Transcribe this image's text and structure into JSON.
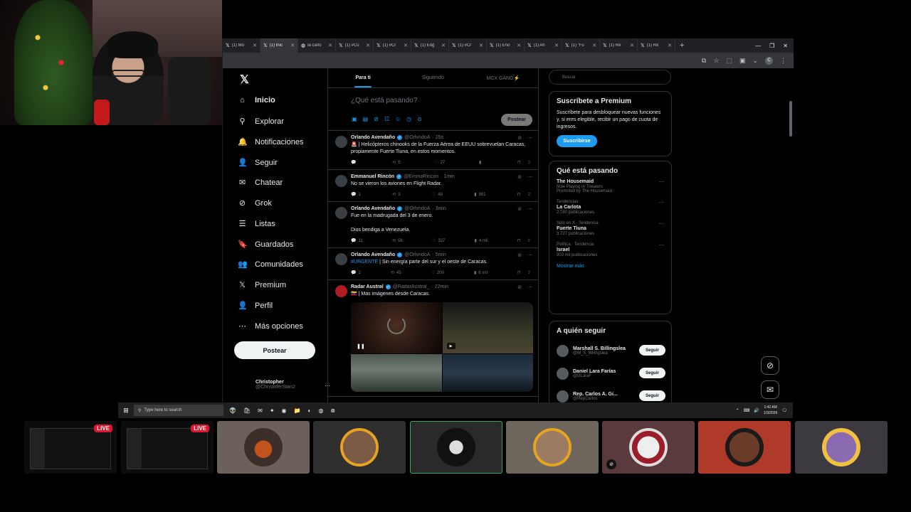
{
  "colors": {
    "accent": "#1d9bf0",
    "live": "#e0162e",
    "selected_border": "#3ba55d"
  },
  "browser": {
    "tabs": [
      {
        "icon": "x-icon",
        "label": "(1) Mo"
      },
      {
        "icon": "x-icon",
        "label": "(1) Inic",
        "active": true
      },
      {
        "icon": "globe-icon",
        "label": "la carlo"
      },
      {
        "icon": "x-icon",
        "label": "(1) #Cu"
      },
      {
        "icon": "x-icon",
        "label": "(1) #Cr"
      },
      {
        "icon": "x-icon",
        "label": "(1) Edg"
      },
      {
        "icon": "x-icon",
        "label": "(1) #Cr"
      },
      {
        "icon": "x-icon",
        "label": "(1) Eno"
      },
      {
        "icon": "x-icon",
        "label": "(1) Ah"
      },
      {
        "icon": "x-icon",
        "label": "(1) \"Fu"
      },
      {
        "icon": "x-icon",
        "label": "(1) Re"
      },
      {
        "icon": "x-icon",
        "label": "(1) Re"
      }
    ],
    "newtab": "+"
  },
  "nav": {
    "logo": "𝕏",
    "items": [
      {
        "icon": "home-icon",
        "glyph": "⌂",
        "label": "Inicio",
        "bold": true
      },
      {
        "icon": "search-icon",
        "glyph": "⚲",
        "label": "Explorar"
      },
      {
        "icon": "bell-icon",
        "glyph": "🔔",
        "label": "Notificaciones"
      },
      {
        "icon": "follow-icon",
        "glyph": "👤",
        "label": "Seguir"
      },
      {
        "icon": "mail-icon",
        "glyph": "✉",
        "label": "Chatear"
      },
      {
        "icon": "grok-icon",
        "glyph": "⊘",
        "label": "Grok"
      },
      {
        "icon": "list-icon",
        "glyph": "☰",
        "label": "Listas"
      },
      {
        "icon": "bookmark-icon",
        "glyph": "🔖",
        "label": "Guardados"
      },
      {
        "icon": "communities-icon",
        "glyph": "👥",
        "label": "Comunidades"
      },
      {
        "icon": "premium-icon",
        "glyph": "𝕏",
        "label": "Premium"
      },
      {
        "icon": "profile-icon",
        "glyph": "👤",
        "label": "Perfil"
      },
      {
        "icon": "more-icon",
        "glyph": "⋯",
        "label": "Más opciones"
      }
    ],
    "post_label": "Postear",
    "account": {
      "name": "Christopher",
      "handle": "@ChristoferStan2"
    }
  },
  "feed": {
    "tabs": [
      "Para ti",
      "Siguiendo",
      "MCX GANG⚡"
    ],
    "composer_placeholder": "¿Qué está pasando?",
    "composer_post": "Postear",
    "tweets": [
      {
        "name": "Orlando Avendaño",
        "handle": "@OrlvndoA",
        "time": "· 25s",
        "text": "🚨 | Helicópteros chinooks de la Fuerza Aérea de EEUU sobrevuelan Caracas, propiamente Fuerte Tiuna, en estos momentos.",
        "reply": "",
        "retweet": "5",
        "like": "27",
        "views": ""
      },
      {
        "name": "Emmanuel Rincón",
        "handle": "@EmmaRincon",
        "time": "· 1min",
        "text": "No se vieron los aviones en Flight Radar.",
        "reply": "1",
        "retweet": "3",
        "like": "48",
        "views": "981"
      },
      {
        "name": "Orlando Avendaño",
        "handle": "@OrlvndoA",
        "time": "· 3min",
        "text": "Fue en la madrugada del 3 de enero.\n\nDios bendiga a Venezuela.",
        "reply": "11",
        "retweet": "56",
        "like": "327",
        "views": "4 mil"
      },
      {
        "name": "Orlando Avendaño",
        "handle": "@OrlvndoA",
        "time": "· 5min",
        "link": "#URGENTE",
        "text": " | Sin energía parte del sur y el oeste de Caracas.",
        "reply": "2",
        "retweet": "45",
        "like": "200",
        "views": "6 mil"
      },
      {
        "name": "Radar Austral",
        "handle": "@RadarAustral_",
        "time": "· 22min",
        "text": "🇻🇪 | Mas imágenes desde Caracas."
      }
    ]
  },
  "right": {
    "search_placeholder": "Buscar",
    "premium": {
      "title": "Suscríbete a Premium",
      "text": "Suscríbete para desbloquear nuevas funciones y, si eres elegible, recibir un pago de cuota de ingresos.",
      "button": "Suscribirse"
    },
    "trends": {
      "title": "Qué está pasando",
      "items": [
        {
          "context": "",
          "title": "The Housemaid",
          "count": "Now Playing In Theaters",
          "promo": "Promoted by The Housemaid"
        },
        {
          "context": "Tendencias",
          "title": "La Carlota",
          "count": "2.780 publicaciones"
        },
        {
          "context": "Solo en X · Tendencia",
          "title": "Fuerte Tiuna",
          "count": "3.727 publicaciones"
        },
        {
          "context": "Política · Tendencia",
          "title": "Israel",
          "count": "903 mil publicaciones"
        }
      ],
      "more": "Mostrar más"
    },
    "follow": {
      "title": "A quién seguir",
      "items": [
        {
          "name": "Marshall S. Billingslea",
          "handle": "@M_S_Billingslea",
          "button": "Seguir"
        },
        {
          "name": "Daniel Lara Farías",
          "handle": "@DLaraF",
          "button": "Seguir"
        },
        {
          "name": "Rep. Carlos A. Gi...",
          "handle": "@RepCarlos",
          "button": "Seguir"
        }
      ]
    }
  },
  "taskbar": {
    "search_placeholder": "Type here to search",
    "time": "1:42 AM",
    "date": "1/3/2026"
  },
  "tiles": {
    "live_label": "LIVE"
  }
}
